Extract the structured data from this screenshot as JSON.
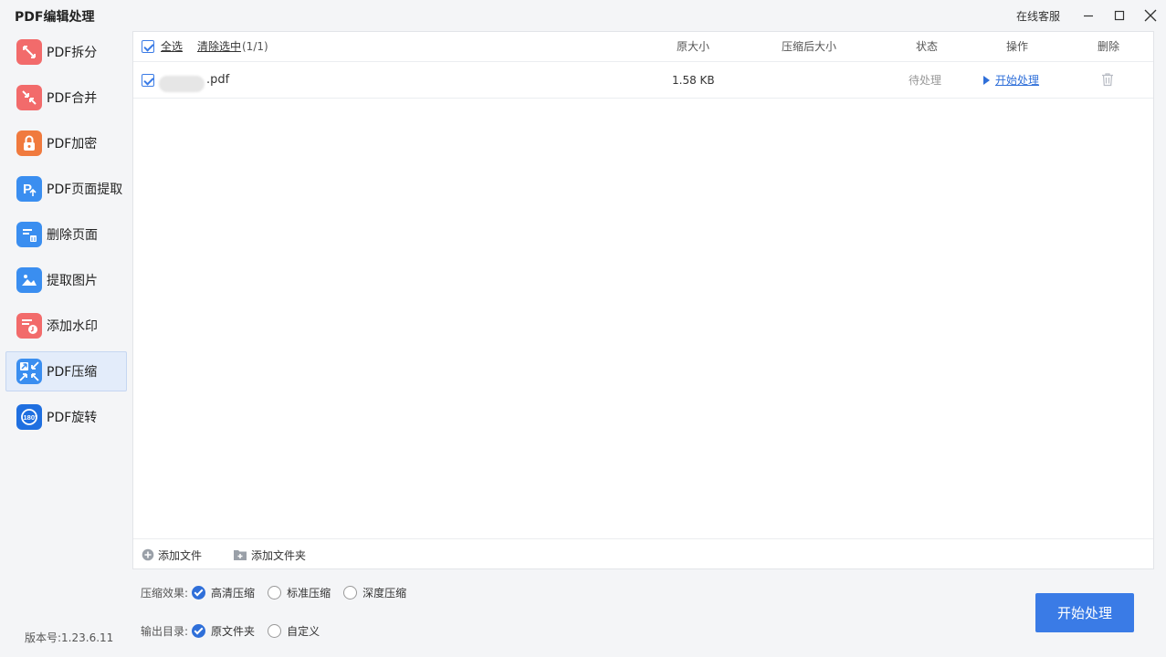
{
  "app": {
    "title": "PDF编辑处理",
    "support": "在线客服"
  },
  "colors": {
    "accent": "#3a7be6",
    "link": "#2f6fd9",
    "active_bg": "#e3ecfa"
  },
  "sidebar": {
    "items": [
      {
        "label": "PDF拆分",
        "icon": "split-icon"
      },
      {
        "label": "PDF合并",
        "icon": "merge-icon"
      },
      {
        "label": "PDF加密",
        "icon": "lock-icon"
      },
      {
        "label": "PDF页面提取",
        "icon": "page-extract-icon"
      },
      {
        "label": "删除页面",
        "icon": "delete-page-icon"
      },
      {
        "label": "提取图片",
        "icon": "image-icon"
      },
      {
        "label": "添加水印",
        "icon": "watermark-icon"
      },
      {
        "label": "PDF压缩",
        "icon": "compress-icon",
        "active": true
      },
      {
        "label": "PDF旋转",
        "icon": "rotate-icon"
      }
    ],
    "version": "版本号:1.23.6.11"
  },
  "table": {
    "select_all": "全选",
    "clear_selection": "清除选中",
    "selection_count": "(1/1)",
    "headers": {
      "size": "原大小",
      "compressed": "压缩后大小",
      "status": "状态",
      "action": "操作",
      "delete": "删除"
    },
    "rows": [
      {
        "filename_suffix": ".pdf",
        "size": "1.58 KB",
        "compressed": "",
        "status": "待处理",
        "action": "开始处理"
      }
    ]
  },
  "footer": {
    "add_file": "添加文件",
    "add_folder": "添加文件夹"
  },
  "options": {
    "effect_label": "压缩效果:",
    "effect_options": [
      "高清压缩",
      "标准压缩",
      "深度压缩"
    ],
    "output_label": "输出目录:",
    "output_options": [
      "原文件夹",
      "自定义"
    ]
  },
  "start_button": "开始处理"
}
